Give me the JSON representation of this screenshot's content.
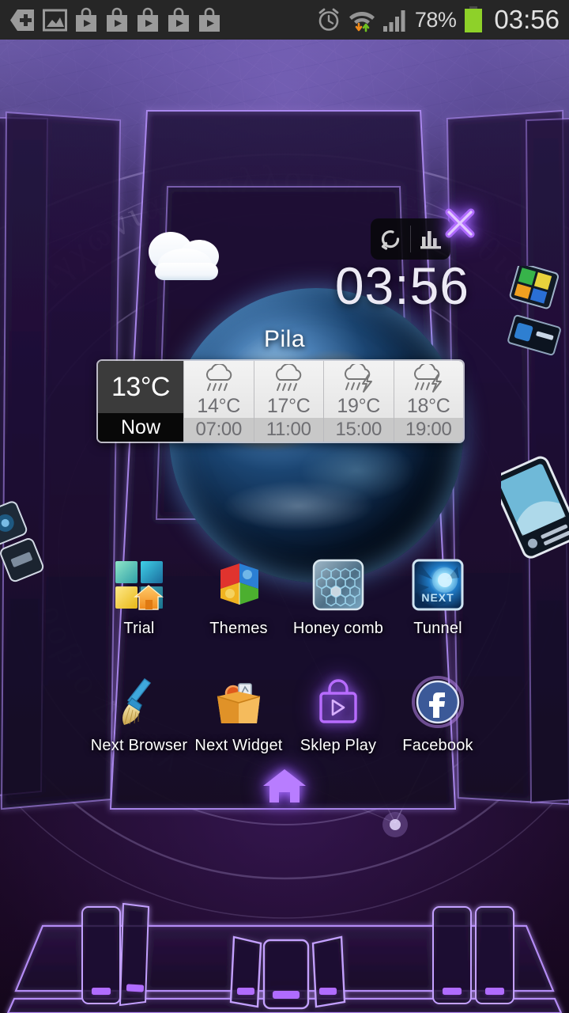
{
  "statusbar": {
    "icons_left": [
      {
        "name": "add-badge-icon",
        "glyph": "plus-hexagon"
      },
      {
        "name": "gallery-image-icon",
        "glyph": "picture"
      },
      {
        "name": "play-store-download-icon-1",
        "glyph": "play-bag"
      },
      {
        "name": "play-store-download-icon-2",
        "glyph": "play-bag"
      },
      {
        "name": "play-store-download-icon-3",
        "glyph": "play-bag"
      },
      {
        "name": "play-store-download-icon-4",
        "glyph": "play-bag"
      },
      {
        "name": "play-store-download-icon-5",
        "glyph": "play-bag"
      }
    ],
    "icons_right": [
      {
        "name": "alarm-clock-icon",
        "glyph": "alarm"
      },
      {
        "name": "wifi-data-transfer-icon",
        "glyph": "wifi-arrows"
      },
      {
        "name": "cellular-signal-icon",
        "glyph": "signal-bars"
      }
    ],
    "battery_percent": "78%",
    "battery_color": "#8ed129",
    "clock": "03:56"
  },
  "weather_widget": {
    "city": "Pila",
    "clock": "03:56",
    "condition_icon": "cloud-icon",
    "controls": [
      {
        "name": "refresh-button",
        "icon": "refresh-icon"
      },
      {
        "name": "forecast-chart-button",
        "icon": "bar-chart-icon"
      }
    ],
    "close_button": {
      "name": "close-widget-button",
      "icon": "close-x-icon",
      "color": "#b06cff"
    },
    "now": {
      "temperature": "13°C",
      "label": "Now"
    },
    "forecast": [
      {
        "temperature": "14°C",
        "time": "07:00",
        "icon": "rain-icon"
      },
      {
        "temperature": "17°C",
        "time": "11:00",
        "icon": "rain-icon"
      },
      {
        "temperature": "19°C",
        "time": "15:00",
        "icon": "thunderstorm-icon"
      },
      {
        "temperature": "18°C",
        "time": "19:00",
        "icon": "thunderstorm-icon"
      }
    ]
  },
  "app_grid": {
    "rows": [
      [
        {
          "label": "Trial",
          "icon": "next-launcher-trial-icon"
        },
        {
          "label": "Themes",
          "icon": "themes-puzzle-icon"
        },
        {
          "label": "Honey comb",
          "icon": "honeycomb-icon"
        },
        {
          "label": "Tunnel",
          "icon": "tunnel-next-icon"
        }
      ],
      [
        {
          "label": "Next Browser",
          "icon": "broom-icon"
        },
        {
          "label": "Next Widget",
          "icon": "widget-box-icon"
        },
        {
          "label": "Sklep Play",
          "icon": "play-store-bag-icon"
        },
        {
          "label": "Facebook",
          "icon": "facebook-icon"
        }
      ]
    ]
  },
  "home_button": {
    "name": "home-icon",
    "color": "#b87dff"
  },
  "theme": {
    "accent": "#a46bff",
    "neon": "#9d63f5",
    "wallpaper_top": "#6f5fa8",
    "wallpaper_bottom": "#120616",
    "label_text": "#ffffff"
  },
  "wallpaper": {
    "greek_text_outer": "Θεωρ Ἰγχωνια Διαλλοιοποιει νοθιοο",
    "greek_text_inner": "ροβιο Διαλλ"
  }
}
